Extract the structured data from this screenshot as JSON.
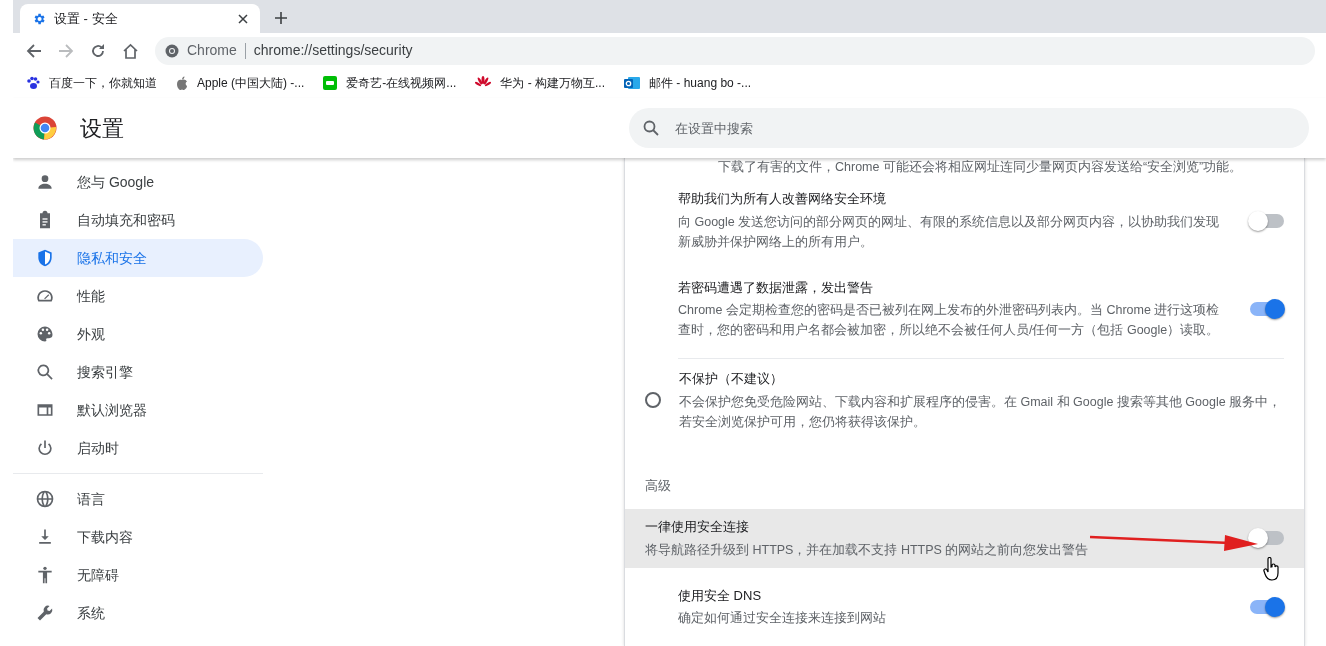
{
  "tab": {
    "title": "设置 - 安全"
  },
  "address_bar": {
    "site": "Chrome",
    "url": "chrome://settings/security"
  },
  "bookmarks": [
    {
      "label": "百度一下，你就知道"
    },
    {
      "label": "Apple (中国大陆) -..."
    },
    {
      "label": "爱奇艺-在线视频网..."
    },
    {
      "label": "华为 - 构建万物互..."
    },
    {
      "label": "邮件 - huang bo -..."
    }
  ],
  "settings_header": {
    "title": "设置",
    "search": {
      "placeholder": "在设置中搜索"
    }
  },
  "sidebar": {
    "groups": [
      [
        {
          "label": "您与 Google",
          "selected": false
        },
        {
          "label": "自动填充和密码",
          "selected": false
        },
        {
          "label": "隐私和安全",
          "selected": true
        },
        {
          "label": "性能",
          "selected": false
        },
        {
          "label": "外观",
          "selected": false
        },
        {
          "label": "搜索引擎",
          "selected": false
        },
        {
          "label": "默认浏览器",
          "selected": false
        },
        {
          "label": "启动时",
          "selected": false
        }
      ],
      [
        {
          "label": "语言",
          "selected": false
        },
        {
          "label": "下载内容",
          "selected": false
        },
        {
          "label": "无障碍",
          "selected": false
        },
        {
          "label": "系统",
          "selected": false
        }
      ]
    ]
  },
  "content": {
    "items": [
      {
        "kind": "text",
        "text": "下载了有害的文件，Chrome 可能还会将相应网址连同少量网页内容发送给“安全浏览”功能。"
      },
      {
        "kind": "toggle",
        "title": "帮助我们为所有人改善网络安全环境",
        "description": "向 Google 发送您访问的部分网页的网址、有限的系统信息以及部分网页内容，以协助我们发现新威胁并保护网络上的所有用户。",
        "on": false,
        "highlighted": false
      },
      {
        "kind": "toggle",
        "title": "若密码遭遇了数据泄露，发出警告",
        "description": "Chrome 会定期检查您的密码是否已被列在网上发布的外泄密码列表内。当 Chrome 进行这项检查时，您的密码和用户名都会被加密，所以绝不会被任何人员/任何一方（包括 Google）读取。",
        "on": true,
        "highlighted": false
      },
      {
        "kind": "radio",
        "title": "不保护（不建议）",
        "description": "不会保护您免受危险网站、下载内容和扩展程序的侵害。在 Gmail 和 Google 搜索等其他 Google 服务中，若安全浏览保护可用，您仍将获得该保护。",
        "selected": false
      },
      {
        "kind": "heading",
        "text": "高级"
      },
      {
        "kind": "toggle",
        "title": "一律使用安全连接",
        "description": "将导航路径升级到 HTTPS，并在加载不支持 HTTPS 的网站之前向您发出警告",
        "on": false,
        "highlighted": true
      },
      {
        "kind": "toggle",
        "title": "使用安全 DNS",
        "description": "确定如何通过安全连接来连接到网站",
        "on": true,
        "highlighted": false
      }
    ]
  }
}
